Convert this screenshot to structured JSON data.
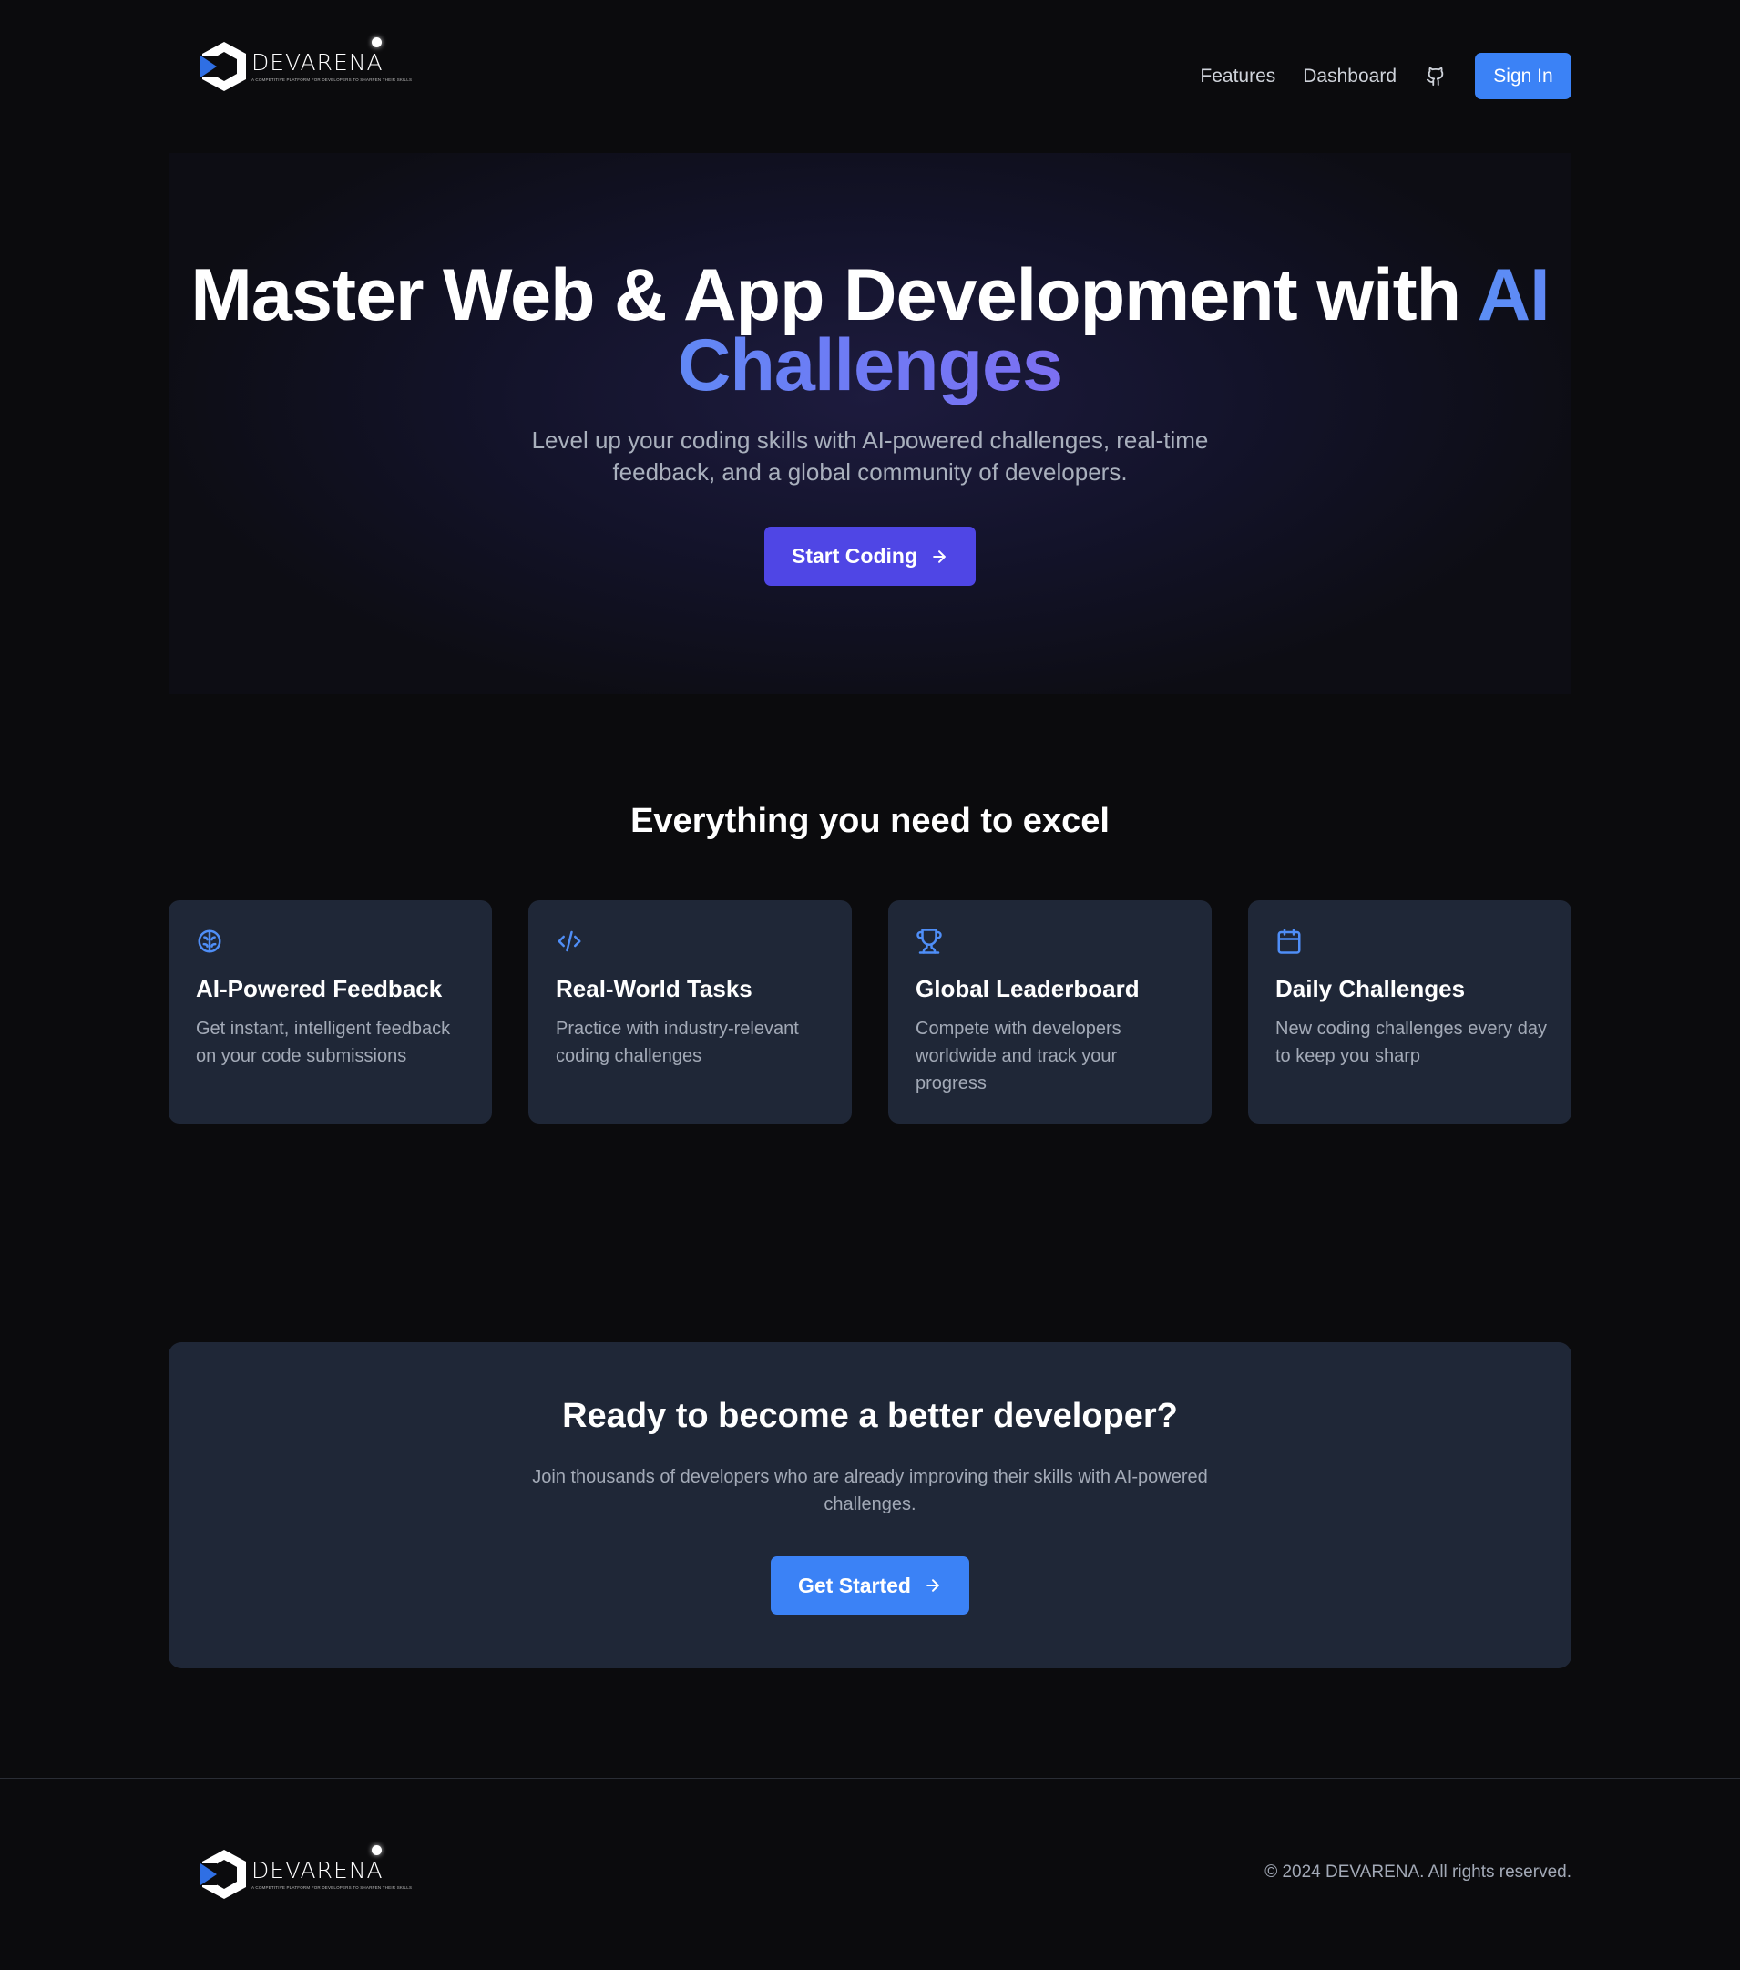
{
  "brand": {
    "name": "DEVARENA",
    "tagline": "A COMPETITIVE PLATFORM FOR DEVELOPERS TO SHARPEN THEIR SKILLS"
  },
  "nav": {
    "features": "Features",
    "dashboard": "Dashboard",
    "github_icon": "github-icon",
    "sign_in": "Sign In"
  },
  "hero": {
    "title_main": "Master Web & App Development with ",
    "title_accent": "AI Challenges",
    "subtitle": "Level up your coding skills with AI-powered challenges, real-time feedback, and a global community of developers.",
    "cta": "Start Coding"
  },
  "features": {
    "heading": "Everything you need to excel",
    "items": [
      {
        "icon": "brain-icon",
        "title": "AI-Powered Feedback",
        "desc": "Get instant, intelligent feedback on your code submissions"
      },
      {
        "icon": "code-icon",
        "title": "Real-World Tasks",
        "desc": "Practice with industry-relevant coding challenges"
      },
      {
        "icon": "trophy-icon",
        "title": "Global Leaderboard",
        "desc": "Compete with developers worldwide and track your progress"
      },
      {
        "icon": "calendar-icon",
        "title": "Daily Challenges",
        "desc": "New coding challenges every day to keep you sharp"
      }
    ]
  },
  "cta": {
    "title": "Ready to become a better developer?",
    "subtitle": "Join thousands of developers who are already improving their skills with AI-powered challenges.",
    "button": "Get Started"
  },
  "footer": {
    "copyright": "© 2024 DEVARENA. All rights reserved."
  },
  "colors": {
    "background": "#0b0b0d",
    "card": "#1f2737",
    "primary_blue": "#3b82f6",
    "indigo": "#4f46e5",
    "icon_blue": "#4f8ef7"
  }
}
